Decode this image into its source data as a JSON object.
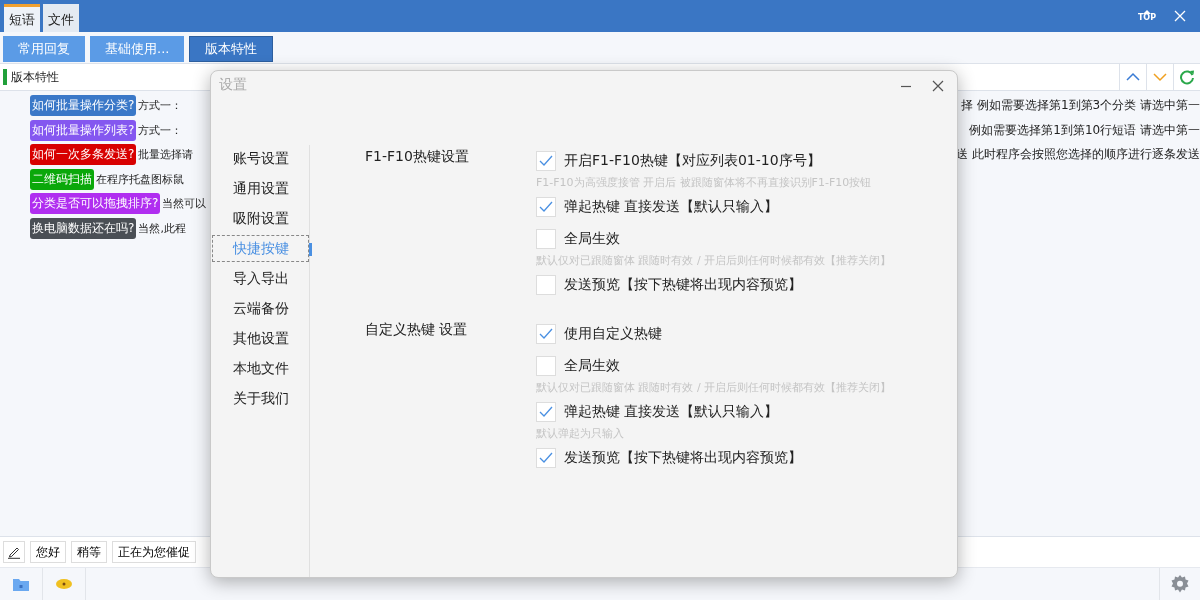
{
  "window": {
    "tabs": [
      {
        "label": "短语",
        "selected": true
      },
      {
        "label": "文件",
        "selected": false
      }
    ],
    "top_button": "TOP",
    "category_buttons": [
      {
        "label": "常用回复",
        "selected": false
      },
      {
        "label": "基础使用...",
        "selected": false
      },
      {
        "label": "版本特性",
        "selected": true
      }
    ],
    "section_title": "版本特性",
    "rows": [
      {
        "tag": "如何批量操作分类?",
        "color": "#3a78c8",
        "text_left": "方式一：",
        "text_right": "择  例如需要选择第1到第3个分类  请选中第一"
      },
      {
        "tag": "如何批量操作列表?",
        "color": "#8457f0",
        "text_left": "方式一：",
        "text_right": "例如需要选择第1到第10行短语  请选中第一"
      },
      {
        "tag": "如何一次多条发送?",
        "color": "#d80000",
        "text_left": "批量选择请",
        "text_right": "送 此时程序会按照您选择的顺序进行逐条发送"
      },
      {
        "tag": "二维码扫描",
        "color": "#0aa80a",
        "text_left": "在程序托盘图标鼠"
      },
      {
        "tag": "分类是否可以拖拽排序?",
        "color": "#b02ef0",
        "text_left": "当然可以"
      },
      {
        "tag": "换电脑数据还在吗?",
        "color": "#4a4f55",
        "text_left": "当然,此程"
      }
    ],
    "quick_replies": [
      "您好",
      "稍等",
      "正在为您催促"
    ]
  },
  "dialog": {
    "title": "设置",
    "nav": [
      {
        "label": "账号设置",
        "selected": false
      },
      {
        "label": "通用设置",
        "selected": false
      },
      {
        "label": "吸附设置",
        "selected": false
      },
      {
        "label": "快捷按键",
        "selected": true
      },
      {
        "label": "导入导出",
        "selected": false
      },
      {
        "label": "云端备份",
        "selected": false
      },
      {
        "label": "其他设置",
        "selected": false
      },
      {
        "label": "本地文件",
        "selected": false
      },
      {
        "label": "关于我们",
        "selected": false
      }
    ],
    "groups": [
      {
        "title": "F1-F10热键设置",
        "items": [
          {
            "kind": "checkbox",
            "label": "开启F1-F10热键【对应列表01-10序号】",
            "checked": true
          },
          {
            "kind": "hint",
            "text": "F1-F10为高强度接管 开启后 被跟随窗体将不再直接识别F1-F10按钮"
          },
          {
            "kind": "checkbox",
            "label": "弹起热键 直接发送【默认只输入】",
            "checked": true
          },
          {
            "kind": "checkbox",
            "label": "全局生效",
            "checked": false
          },
          {
            "kind": "hint",
            "text": "默认仅对已跟随窗体 跟随时有效 / 开启后则任何时候都有效【推荐关闭】"
          },
          {
            "kind": "checkbox",
            "label": "发送预览【按下热键将出现内容预览】",
            "checked": false
          }
        ]
      },
      {
        "title": "自定义热键 设置",
        "items": [
          {
            "kind": "checkbox",
            "label": "使用自定义热键",
            "checked": true
          },
          {
            "kind": "checkbox",
            "label": "全局生效",
            "checked": false
          },
          {
            "kind": "hint",
            "text": "默认仅对已跟随窗体 跟随时有效 / 开启后则任何时候都有效【推荐关闭】"
          },
          {
            "kind": "checkbox",
            "label": "弹起热键 直接发送【默认只输入】",
            "checked": true
          },
          {
            "kind": "hint",
            "text": "默认弹起为只输入"
          },
          {
            "kind": "checkbox",
            "label": "发送预览【按下热键将出现内容预览】",
            "checked": true
          }
        ]
      }
    ]
  }
}
